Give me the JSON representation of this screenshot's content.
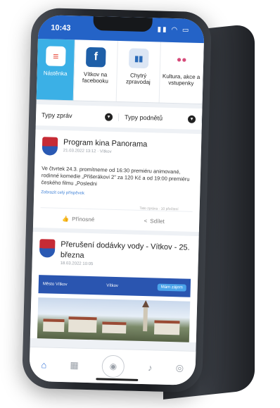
{
  "status": {
    "time": "10:43",
    "icons": "▮▮ ◠ ▭"
  },
  "quick_links": [
    {
      "label": "Nástěnka",
      "icon": "news-icon"
    },
    {
      "label": "Vítkov na facebooku",
      "icon": "facebook-icon",
      "glyph": "f"
    },
    {
      "label": "Chytrý zpravodaj",
      "icon": "city-news-icon",
      "glyph": "▮▮"
    },
    {
      "label": "Kultura, akce a vstupenky",
      "icon": "culture-icon",
      "glyph": "●●"
    }
  ],
  "filters": {
    "left": "Typy zpráv",
    "right": "Typy podnětů"
  },
  "post1": {
    "title": "Program kina Panorama",
    "meta": "21.03.2022 13:12 · Vítkov",
    "body": "Ve čtvrtek 24.3. promítneme od 16:30 premiéru animované, rodinné komedie „Přišerákovi 2\" za 120 Kč a od 19:00 premiéru českého filmu „Posledni",
    "link": "Zobrazit celý příspěvek",
    "reactions": "Tato zpráva · 10 přečtení",
    "like_label": "Přínosné",
    "share_label": "Sdílet"
  },
  "post2": {
    "title": "Přerušení dodávky vody - Vítkov - 25. března",
    "meta": "18.03.2022 10:05",
    "banner_left": "Město Vítkov",
    "banner_mid": "Vítkov",
    "banner_btn": "Mám zájem"
  },
  "tabs": [
    {
      "name": "home-icon",
      "glyph": "⌂"
    },
    {
      "name": "grid-icon",
      "glyph": "▦"
    },
    {
      "name": "camera-icon",
      "glyph": "◉"
    },
    {
      "name": "bell-icon",
      "glyph": "♪"
    },
    {
      "name": "profile-icon",
      "glyph": "◎"
    }
  ],
  "colors": {
    "accent": "#2463c7",
    "active_tile": "#3bb0e6"
  }
}
